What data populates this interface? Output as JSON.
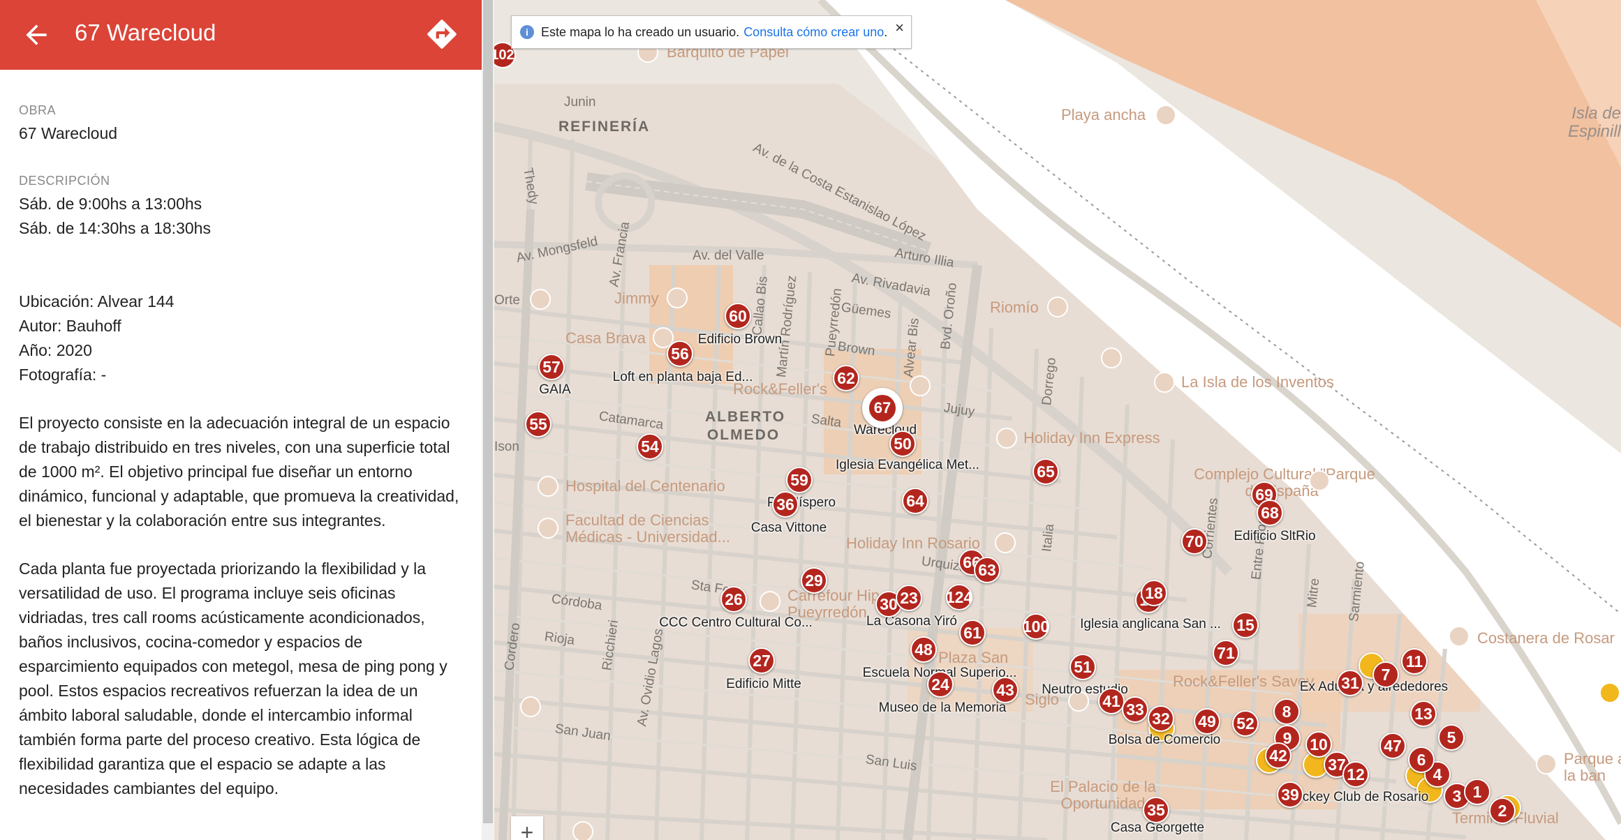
{
  "header": {
    "title": "67 Warecloud",
    "back_icon": "arrow-left-icon",
    "directions_icon": "directions-icon",
    "color": "#db4437"
  },
  "details": {
    "obra_label": "OBRA",
    "obra_value": "67 Warecloud",
    "descripcion_label": "DESCRIPCIÓN",
    "horario_1": "Sáb. de 9:00hs a 13:00hs",
    "horario_2": "Sáb. de 14:30hs a 18:30hs",
    "ubicacion": "Ubicación: Alvear 144",
    "autor": "Autor: Bauhoff",
    "anio": "Año: 2020",
    "fotografia": "Fotografía: -",
    "parrafo_1": "El proyecto consiste en la adecuación integral de un espacio de trabajo distribuido en tres niveles, con una superficie total de 1000 m². El objetivo principal fue diseñar un entorno dinámico, funcional y adaptable, que promueva la creatividad, el bienestar y la colaboración entre sus integrantes.",
    "parrafo_2": "Cada planta fue proyectada priorizando la flexibilidad y la versatilidad de uso. El programa incluye seis oficinas vidriadas, tres call rooms acústicamente acondicionados, baños inclusivos, cocina-comedor y espacios de esparcimiento equipados con metegol, mesa de ping pong y pool. Estos espacios recreativos refuerzan la idea de un ámbito laboral saludable, donde el intercambio informal también forma parte del proceso creativo. Esta lógica de flexibilidad garantiza que el espacio se adapte a las necesidades cambiantes del equipo."
  },
  "notice": {
    "text": "Este mapa lo ha creado un usuario.",
    "link": "Consulta cómo crear uno",
    "close": "×"
  },
  "zoom": {
    "plus": "+"
  },
  "map": {
    "marker_color": "#b3261e",
    "selected_marker": "67",
    "edge_marker": "102",
    "markers": [
      "60",
      "56",
      "57",
      "55",
      "54",
      "62",
      "67",
      "50",
      "59",
      "36",
      "64",
      "65",
      "69",
      "68",
      "70",
      "66",
      "63",
      "29",
      "26",
      "30",
      "23",
      "124",
      "61",
      "100",
      "19",
      "15",
      "27",
      "48",
      "24",
      "43",
      "51",
      "71",
      "41",
      "33",
      "32",
      "49",
      "52",
      "8",
      "11",
      "7",
      "4",
      "13",
      "5",
      "9",
      "10",
      "47",
      "6",
      "42",
      "37",
      "12",
      "39",
      "35",
      "3",
      "1",
      "2",
      "31",
      "18"
    ],
    "labels": [
      "Edificio Brown",
      "GAIA",
      "Loft en planta baja Ed...",
      "Warecloud",
      "Iglesia Evangélica Met...",
      "PH Níspero",
      "Casa Vittone",
      "Edificio SltRio",
      "CCC Centro Cultural Co...",
      "La Casona Yiró",
      "Iglesia anglicana San ...",
      "Edificio Mitte",
      "Escuela Normal Superio...",
      "Museo de la Memoria",
      "Neutro estudio",
      "Ex Aduana y alrededores",
      "Bolsa de Comercio",
      "Jockey Club de Rosario",
      "Casa Georgette"
    ],
    "streets": [
      "Junin",
      "Av. Mongsfeld",
      "Av. del Valle",
      "Av. de la Costa Estanislao López",
      "Arturo Illia",
      "Av. Rivadavia",
      "Güemes",
      "Brown",
      "Jujuy",
      "Salta",
      "Catamarca",
      "Córdoba",
      "Rioja",
      "San Juan",
      "San Luis",
      "Urquiza",
      "Sta Fe",
      "Bvd. Oroño",
      "Av. Francia",
      "Italia",
      "Entre Ríos",
      "Corrientes",
      "Sarmiento",
      "Mitre",
      "Thedy",
      "Av. Ovidio Lagos",
      "Callao Bis",
      "Martín Rodríguez",
      "Pueyrredón",
      "Alvear Bis",
      "Dorrego",
      "Ricchieri",
      "Cordero",
      "Orte",
      "Ison"
    ],
    "districts": [
      "REFINERÍA",
      "ALBERTO OLMEDO"
    ],
    "pois": [
      "Barquito de Papel",
      "Playa ancha",
      "Jimmy",
      "Casa Brava",
      "Rock&Feller's",
      "Riomío",
      "La Isla de los Inventos",
      "Holiday Inn Express",
      "Hospital del Centenario",
      "Facultad de Ciencias Médicas - Universidad...",
      "Holiday Inn Rosario",
      "Complejo Cultural \"Parque de España\"",
      "Carrefour Hiper Pueyrredón",
      "Plaza San",
      "Rock&Feller's Savoy",
      "Costanera de Rosar",
      "Parque a la ban",
      "El Palacio de la Oportunidad",
      "Terminal Fluvial",
      "Siglo"
    ],
    "river_name": "Isla de Espinill"
  }
}
